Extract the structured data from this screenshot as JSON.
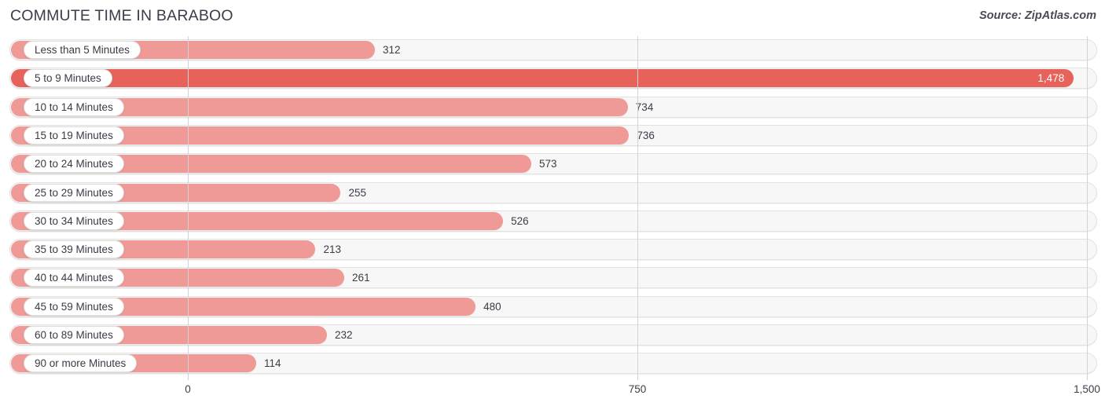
{
  "header": {
    "title": "COMMUTE TIME IN BARABOO",
    "source": "Source: ZipAtlas.com"
  },
  "colors": {
    "bar": "#ef9a96",
    "bar_highlight": "#e8625c",
    "track": "#f7f7f7",
    "track_border": "#e2e2e2",
    "gridline": "#d3d3d7",
    "text": "#3c3c48"
  },
  "axis": {
    "ticks": [
      {
        "label": "0",
        "value": 0
      },
      {
        "label": "750",
        "value": 750
      },
      {
        "label": "1,500",
        "value": 1500
      }
    ],
    "min": 0,
    "max": 1500
  },
  "chart_data": {
    "type": "bar",
    "orientation": "horizontal",
    "title": "COMMUTE TIME IN BARABOO",
    "subtitle": "",
    "xlabel": "",
    "ylabel": "",
    "xlim": [
      0,
      1500
    ],
    "grid": true,
    "legend": false,
    "source": "Source: ZipAtlas.com",
    "categories": [
      "Less than 5 Minutes",
      "5 to 9 Minutes",
      "10 to 14 Minutes",
      "15 to 19 Minutes",
      "20 to 24 Minutes",
      "25 to 29 Minutes",
      "30 to 34 Minutes",
      "35 to 39 Minutes",
      "40 to 44 Minutes",
      "45 to 59 Minutes",
      "60 to 89 Minutes",
      "90 or more Minutes"
    ],
    "values": [
      312,
      1478,
      734,
      736,
      573,
      255,
      526,
      213,
      261,
      480,
      232,
      114
    ],
    "value_labels": [
      "312",
      "1,478",
      "734",
      "736",
      "573",
      "255",
      "526",
      "213",
      "261",
      "480",
      "232",
      "114"
    ],
    "highlight_index": 1
  }
}
